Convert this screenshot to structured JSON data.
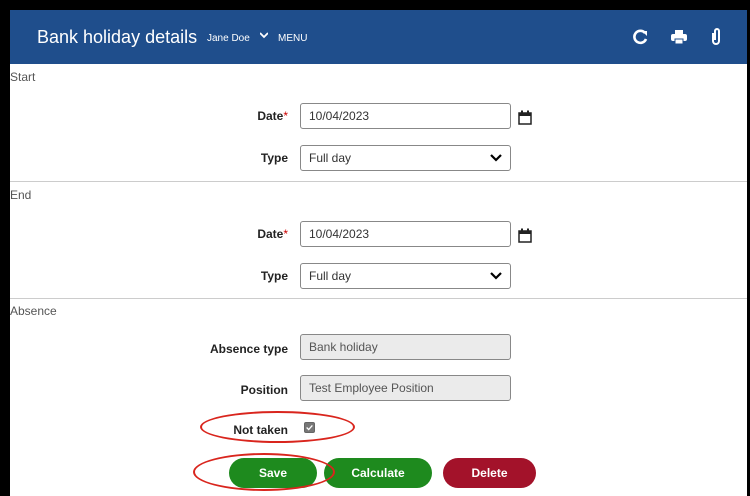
{
  "header": {
    "title": "Bank holiday details",
    "user": "Jane Doe",
    "menu": "MENU",
    "icons": [
      "refresh-icon",
      "print-icon",
      "attachment-icon"
    ]
  },
  "start": {
    "section_label": "Start",
    "date_label": "Date",
    "required_mark": "*",
    "date_value": "10/04/2023",
    "type_label": "Type",
    "type_value": "Full day"
  },
  "end": {
    "section_label": "End",
    "date_label": "Date",
    "required_mark": "*",
    "date_value": "10/04/2023",
    "type_label": "Type",
    "type_value": "Full day"
  },
  "absence": {
    "section_label": "Absence",
    "absence_type_label": "Absence type",
    "absence_type_value": "Bank holiday",
    "position_label": "Position",
    "position_value": "Test Employee Position",
    "not_taken_label": "Not taken",
    "not_taken_checked": true
  },
  "actions": {
    "save": "Save",
    "calculate": "Calculate",
    "delete": "Delete"
  },
  "colors": {
    "header": "#1f4e8c",
    "save": "#1e8a1e",
    "calculate": "#1e8a1e",
    "delete": "#a3122a",
    "highlight": "#d9251d"
  }
}
